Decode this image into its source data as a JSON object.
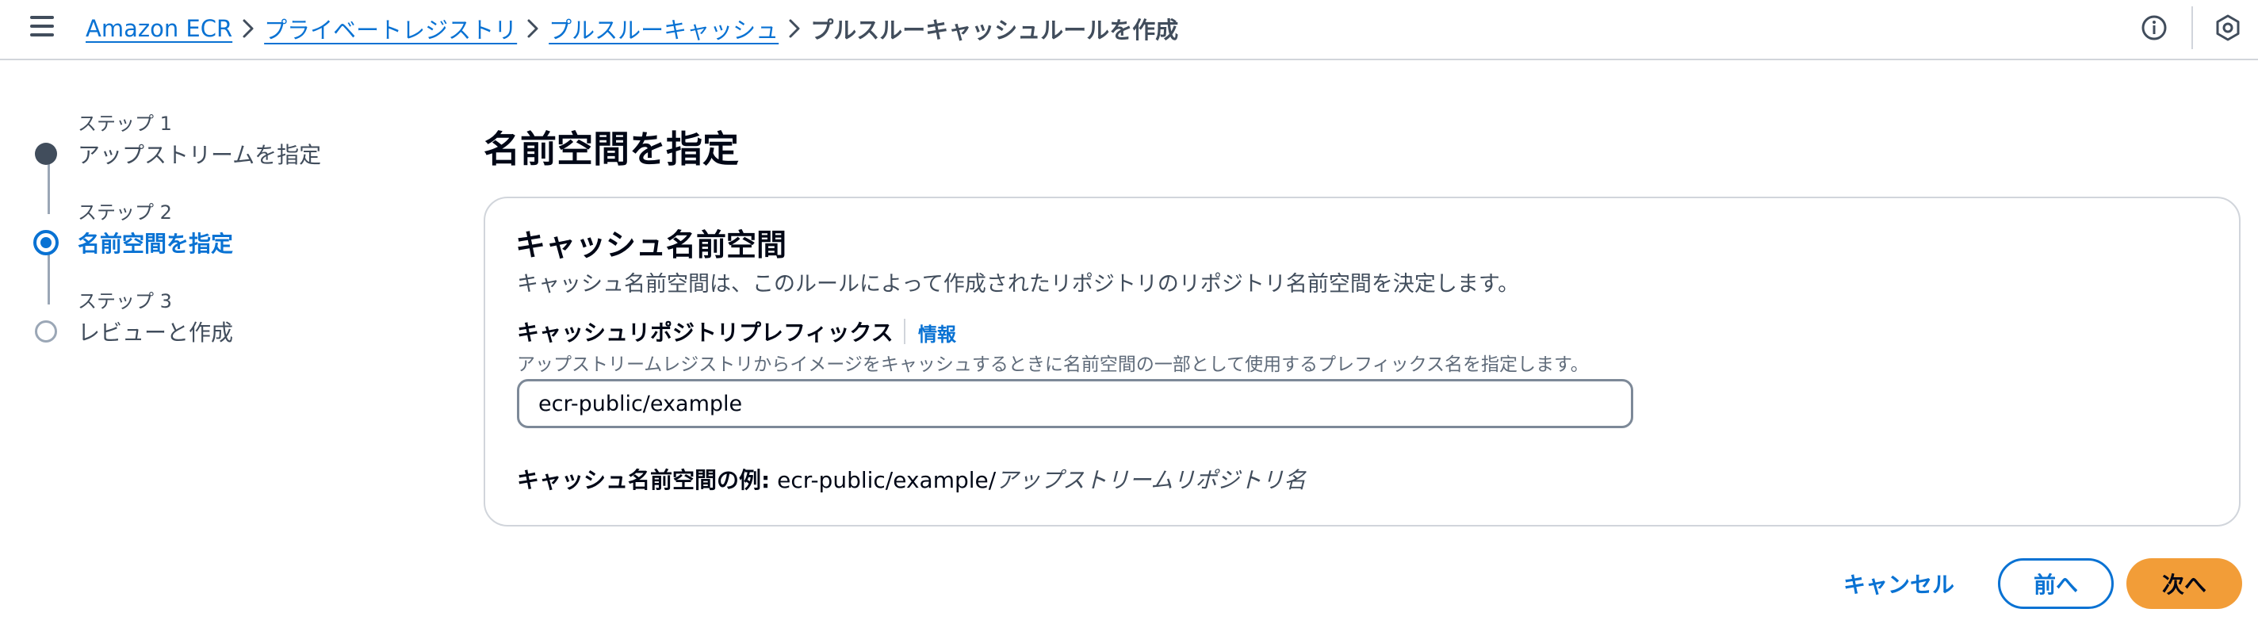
{
  "breadcrumb": {
    "items": [
      "Amazon ECR",
      "プライベートレジストリ",
      "プルスルーキャッシュ"
    ],
    "current": "プルスルーキャッシュルールを作成"
  },
  "icons": {
    "menu": "hamburger-menu-icon",
    "info": "info-circle-icon",
    "settings": "hexagon-settings-icon",
    "separator": "chevron-right-icon"
  },
  "wizard": {
    "steps": [
      {
        "number": "ステップ 1",
        "title": "アップストリームを指定",
        "state": "completed"
      },
      {
        "number": "ステップ 2",
        "title": "名前空間を指定",
        "state": "active"
      },
      {
        "number": "ステップ 3",
        "title": "レビューと作成",
        "state": "pending"
      }
    ]
  },
  "main": {
    "page_title": "名前空間を指定",
    "panel": {
      "title": "キャッシュ名前空間",
      "description": "キャッシュ名前空間は、このルールによって作成されたリポジトリのリポジトリ名前空間を決定します。",
      "field": {
        "label": "キャッシュリポジトリプレフィックス",
        "info_link": "情報",
        "description": "アップストリームレジストリからイメージをキャッシュするときに名前空間の一部として使用するプレフィックス名を指定します。",
        "value": "ecr-public/example"
      },
      "example": {
        "label": "キャッシュ名前空間の例:",
        "prefix": "ecr-public/example/",
        "suffix": "アップストリームリポジトリ名"
      }
    }
  },
  "actions": {
    "cancel": "キャンセル",
    "previous": "前へ",
    "next": "次へ"
  },
  "colors": {
    "link": "#0972d3",
    "primary_button": "#f29d38",
    "completed_step": "#414d5c",
    "text": "#000716"
  }
}
